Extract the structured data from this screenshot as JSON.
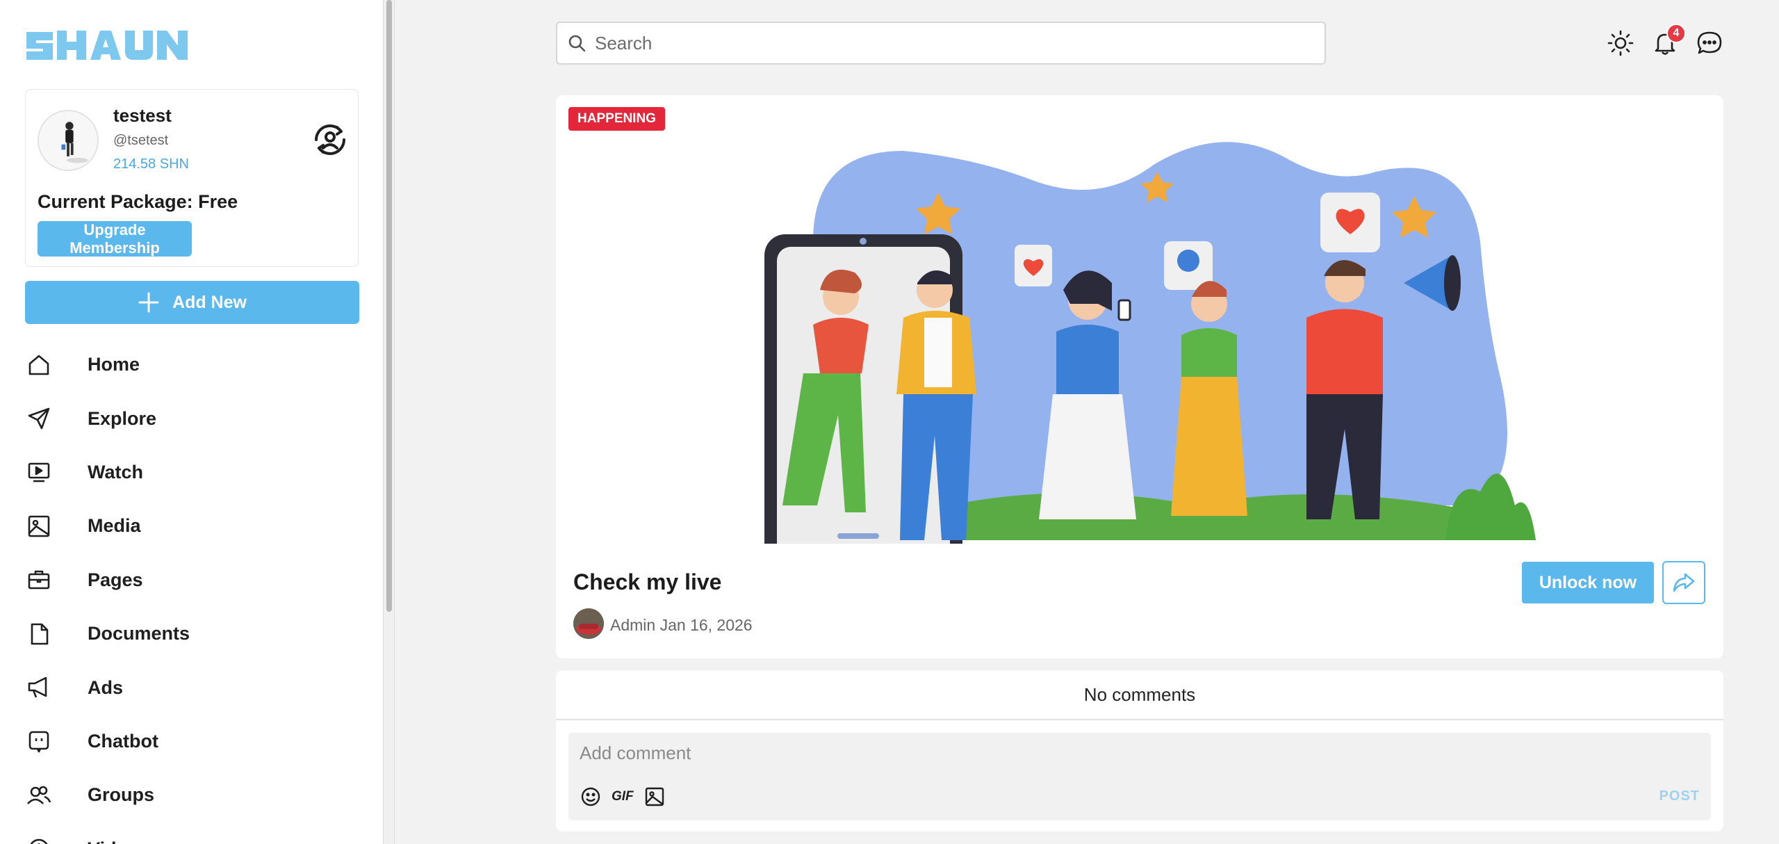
{
  "brand": {
    "name": "SHAUN"
  },
  "profile": {
    "name": "testest",
    "handle": "@tsetest",
    "balance": "214.58 SHN",
    "package_label": "Current Package: Free",
    "upgrade_label": "Upgrade Membership"
  },
  "actions": {
    "add_new_label": "Add New"
  },
  "nav": {
    "items": [
      {
        "label": "Home",
        "icon": "home-icon"
      },
      {
        "label": "Explore",
        "icon": "paper-plane-icon"
      },
      {
        "label": "Watch",
        "icon": "video-icon"
      },
      {
        "label": "Media",
        "icon": "image-icon"
      },
      {
        "label": "Pages",
        "icon": "briefcase-icon"
      },
      {
        "label": "Documents",
        "icon": "document-icon"
      },
      {
        "label": "Ads",
        "icon": "megaphone-icon"
      },
      {
        "label": "Chatbot",
        "icon": "chatbot-icon"
      },
      {
        "label": "Groups",
        "icon": "users-icon"
      },
      {
        "label": "Vid",
        "icon": "clock-icon"
      }
    ]
  },
  "search": {
    "placeholder": "Search"
  },
  "header": {
    "notification_count": "4"
  },
  "post": {
    "tag": "HAPPENING",
    "title": "Check my live",
    "author": "Admin",
    "date": "Jan 16, 2026",
    "unlock_label": "Unlock now"
  },
  "comments": {
    "empty_text": "No comments",
    "input_placeholder": "Add comment",
    "gif_label": "GIF",
    "post_label": "POST"
  },
  "colors": {
    "accent": "#5bb8ec",
    "badge": "#e53946",
    "tag": "#e4263a",
    "background": "#f2f2f2"
  }
}
